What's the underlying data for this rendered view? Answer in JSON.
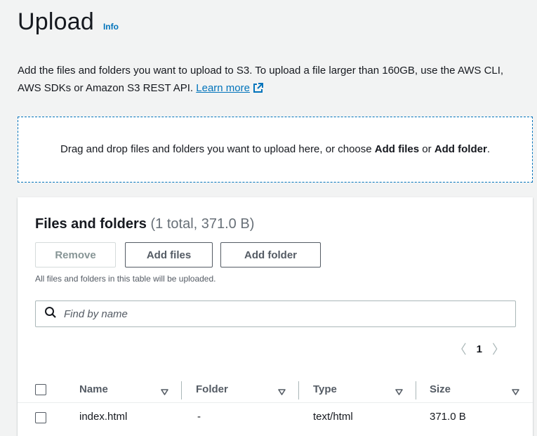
{
  "header": {
    "title": "Upload",
    "info_label": "Info"
  },
  "description": {
    "text": "Add the files and folders you want to upload to S3. To upload a file larger than 160GB, use the AWS CLI, AWS SDKs or Amazon S3 REST API.",
    "learn_more_label": "Learn more"
  },
  "dropzone": {
    "text_before": "Drag and drop files and folders you want to upload here, or choose ",
    "add_files": "Add files",
    "or": " or ",
    "add_folder": "Add folder",
    "period": "."
  },
  "files_panel": {
    "title": "Files and folders",
    "count": "(1 total, 371.0 B)",
    "remove_label": "Remove",
    "add_files_label": "Add files",
    "add_folder_label": "Add folder",
    "helper_text": "All files and folders in this table will be uploaded.",
    "search_placeholder": "Find by name",
    "current_page": "1",
    "columns": [
      "Name",
      "Folder",
      "Type",
      "Size"
    ],
    "rows": [
      {
        "name": "index.html",
        "folder": "-",
        "type": "text/html",
        "size": "371.0 B"
      }
    ]
  },
  "colors": {
    "link": "#0073bb",
    "text": "#16191f",
    "secondary_text": "#545b64",
    "background": "#f2f3f3"
  },
  "icons": {
    "external_link": "external-link-icon",
    "search": "search-icon",
    "sort": "sort-down-icon",
    "prev": "chevron-left-icon",
    "next": "chevron-right-icon"
  }
}
